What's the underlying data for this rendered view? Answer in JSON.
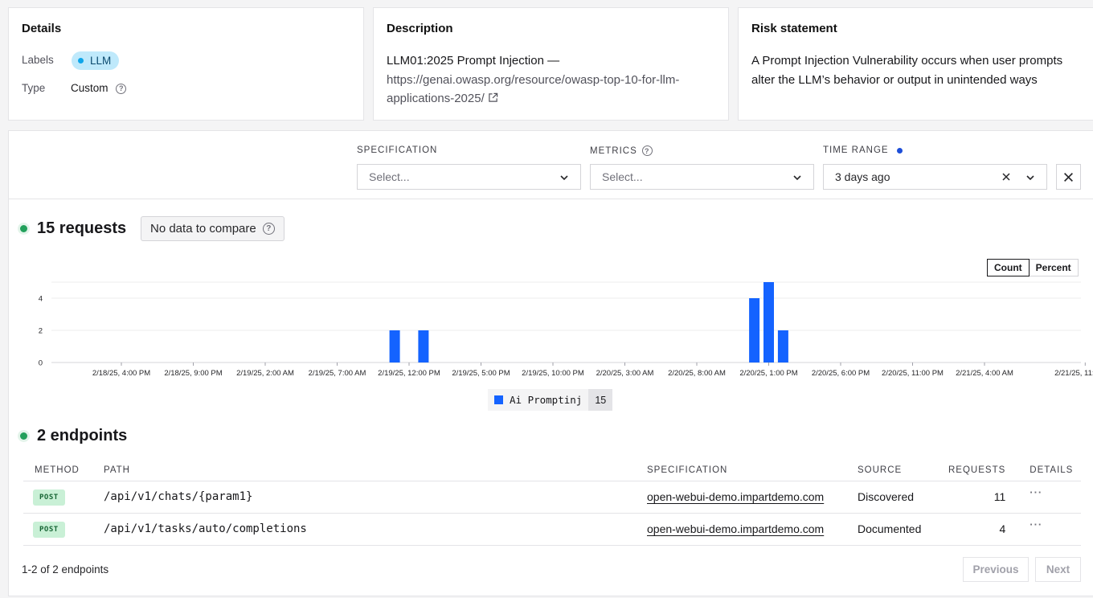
{
  "details": {
    "title": "Details",
    "labels_label": "Labels",
    "labels_value": "LLM",
    "type_label": "Type",
    "type_value": "Custom"
  },
  "description": {
    "title": "Description",
    "text_prefix": "LLM01:2025 Prompt Injection — ",
    "link_text": "https://genai.owasp.org/resource/owasp-top-10-for-llm-applications-2025/"
  },
  "risk": {
    "title": "Risk statement",
    "text": "A Prompt Injection Vulnerability occurs when user prompts alter the LLM’s behavior or output in unintended ways"
  },
  "filters": {
    "specification_label": "SPECIFICATION",
    "specification_placeholder": "Select...",
    "metrics_label": "METRICS",
    "metrics_placeholder": "Select...",
    "time_range_label": "TIME RANGE",
    "time_range_value": "3 days ago"
  },
  "requests": {
    "title": "15 requests",
    "compare_label": "No data to compare",
    "toggle_count": "Count",
    "toggle_percent": "Percent"
  },
  "chart_data": {
    "type": "bar",
    "title": "",
    "xlabel": "",
    "ylabel": "",
    "ylim": [
      0,
      5
    ],
    "yticks": [
      0,
      2,
      4
    ],
    "x_tick_labels": [
      "2/18/25, 4:00 PM",
      "2/18/25, 9:00 PM",
      "2/19/25, 2:00 AM",
      "2/19/25, 7:00 AM",
      "2/19/25, 12:00 PM",
      "2/19/25, 5:00 PM",
      "2/19/25, 10:00 PM",
      "2/20/25, 3:00 AM",
      "2/20/25, 8:00 AM",
      "2/20/25, 1:00 PM",
      "2/20/25, 6:00 PM",
      "2/20/25, 11:00 PM",
      "2/21/25, 4:00 AM",
      "2/21/25, 11:00 AM"
    ],
    "series": [
      {
        "name": "Ai Promptinj",
        "color": "#1463ff",
        "total": "15",
        "points": [
          {
            "x": "2/19/25, 11:00 AM",
            "value": 2
          },
          {
            "x": "2/19/25, 1:00 PM",
            "value": 2
          },
          {
            "x": "2/20/25, 12:00 PM",
            "value": 4
          },
          {
            "x": "2/20/25, 1:00 PM",
            "value": 5
          },
          {
            "x": "2/20/25, 2:00 PM",
            "value": 2
          }
        ]
      }
    ]
  },
  "endpoints": {
    "title": "2 endpoints",
    "columns": [
      "METHOD",
      "PATH",
      "SPECIFICATION",
      "SOURCE",
      "REQUESTS",
      "DETAILS"
    ],
    "rows": [
      {
        "method": "POST",
        "path": "/api/v1/chats/{param1}",
        "spec": "open-webui-demo.impartdemo.com",
        "source": "Discovered",
        "requests": "11",
        "details": "···"
      },
      {
        "method": "POST",
        "path": "/api/v1/tasks/auto/completions",
        "spec": "open-webui-demo.impartdemo.com",
        "source": "Documented",
        "requests": "4",
        "details": "···"
      }
    ],
    "pagination_text": "1-2 of 2 endpoints",
    "previous_label": "Previous",
    "next_label": "Next"
  }
}
